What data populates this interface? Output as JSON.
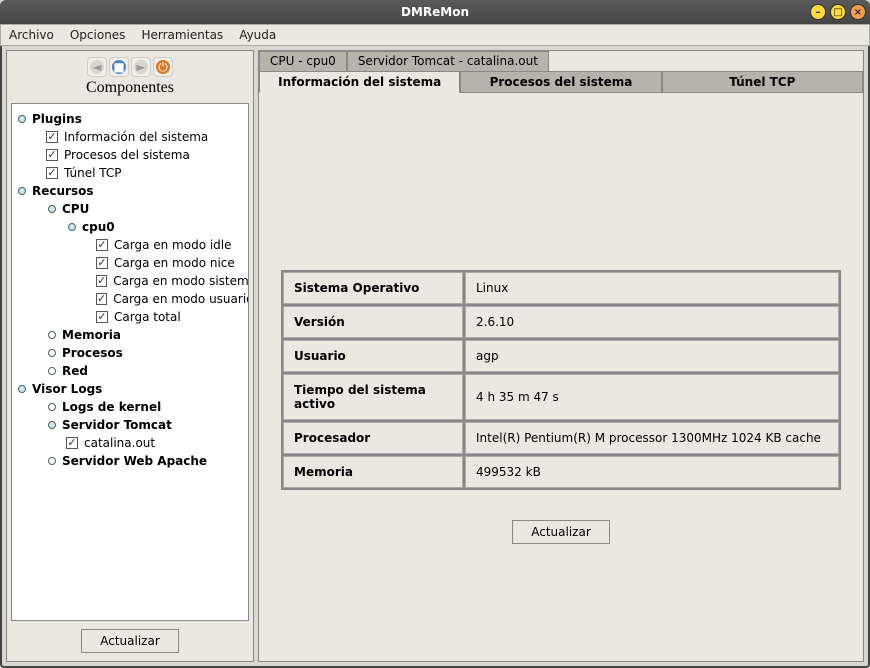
{
  "window": {
    "title": "DMReMon"
  },
  "menubar": [
    "Archivo",
    "Opciones",
    "Herramientas",
    "Ayuda"
  ],
  "sidebar": {
    "title": "Componentes",
    "update_button": "Actualizar",
    "tree": [
      {
        "label": "Plugins",
        "indent": 0,
        "bold": true,
        "key": "open"
      },
      {
        "label": "Información del sistema",
        "indent": 1,
        "checkbox": true,
        "checked": true
      },
      {
        "label": "Procesos del sistema",
        "indent": 1,
        "checkbox": true,
        "checked": true
      },
      {
        "label": "Túnel TCP",
        "indent": 1,
        "checkbox": true,
        "checked": true
      },
      {
        "label": "Recursos",
        "indent": 0,
        "bold": true,
        "key": "open"
      },
      {
        "label": "CPU",
        "indent": 1,
        "bold": true,
        "key": "open"
      },
      {
        "label": "cpu0",
        "indent": 2,
        "bold": true,
        "key": "open"
      },
      {
        "label": "Carga en modo idle",
        "indent": 3,
        "checkbox": true,
        "checked": true
      },
      {
        "label": "Carga en modo nice",
        "indent": 3,
        "checkbox": true,
        "checked": true
      },
      {
        "label": "Carga en modo sistema",
        "indent": 3,
        "checkbox": true,
        "checked": true
      },
      {
        "label": "Carga en modo usuario",
        "indent": 3,
        "checkbox": true,
        "checked": true
      },
      {
        "label": "Carga total",
        "indent": 3,
        "checkbox": true,
        "checked": true
      },
      {
        "label": "Memoria",
        "indent": 1,
        "bold": true,
        "key": "closed"
      },
      {
        "label": "Procesos",
        "indent": 1,
        "bold": true,
        "key": "closed"
      },
      {
        "label": "Red",
        "indent": 1,
        "bold": true,
        "key": "closed"
      },
      {
        "label": "Visor Logs",
        "indent": 0,
        "bold": true,
        "key": "open"
      },
      {
        "label": "Logs de kernel",
        "indent": 1,
        "bold": true,
        "key": "closed"
      },
      {
        "label": "Servidor Tomcat",
        "indent": 1,
        "bold": true,
        "key": "open"
      },
      {
        "label": "catalina.out",
        "indent": 2,
        "checkbox": true,
        "checked": true
      },
      {
        "label": "Servidor Web Apache",
        "indent": 1,
        "bold": true,
        "key": "closed"
      }
    ]
  },
  "main": {
    "top_tabs": [
      {
        "label": "CPU - cpu0",
        "active": false
      },
      {
        "label": "Servidor Tomcat - catalina.out",
        "active": false
      }
    ],
    "sub_tabs": [
      {
        "label": "Información del sistema",
        "active": true
      },
      {
        "label": "Procesos del sistema",
        "active": false
      },
      {
        "label": "Túnel TCP",
        "active": false
      }
    ],
    "info_rows": [
      {
        "key": "Sistema Operativo",
        "value": "Linux"
      },
      {
        "key": "Versión",
        "value": "2.6.10"
      },
      {
        "key": "Usuario",
        "value": "agp"
      },
      {
        "key": "Tiempo del sistema activo",
        "value": "4 h 35 m 47 s"
      },
      {
        "key": "Procesador",
        "value": "Intel(R) Pentium(R) M processor 1300MHz 1024 KB cache"
      },
      {
        "key": "Memoria",
        "value": "499532 kB"
      }
    ],
    "update_button": "Actualizar"
  }
}
